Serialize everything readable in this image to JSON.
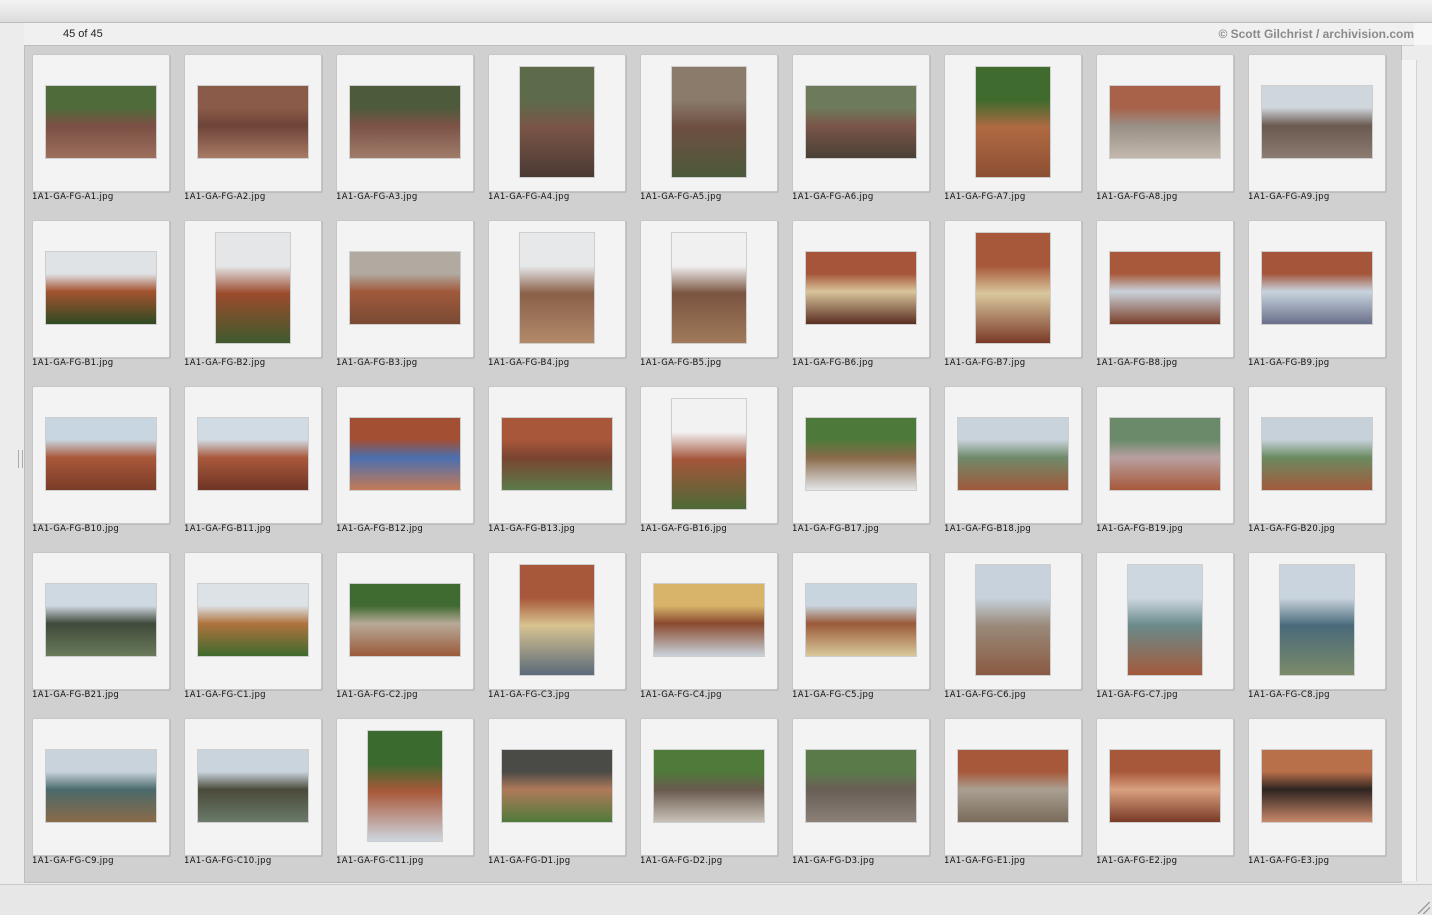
{
  "header": {
    "count": "45 of 45",
    "credit": "© Scott Gilchrist / archivision.com"
  },
  "thumbnails": [
    {
      "name": "1A1-GA-FG-A1.jpg",
      "orientation": "land",
      "palette": [
        "#4f6b3a",
        "#7b5044",
        "#9c6f5c"
      ]
    },
    {
      "name": "1A1-GA-FG-A2.jpg",
      "orientation": "land",
      "palette": [
        "#8a5b49",
        "#6e4438",
        "#a87a66"
      ]
    },
    {
      "name": "1A1-GA-FG-A3.jpg",
      "orientation": "land",
      "palette": [
        "#4e5b3a",
        "#7c5346",
        "#a07c6a"
      ]
    },
    {
      "name": "1A1-GA-FG-A4.jpg",
      "orientation": "port",
      "palette": [
        "#5d6b4a",
        "#7a5547",
        "#4a3a34"
      ]
    },
    {
      "name": "1A1-GA-FG-A5.jpg",
      "orientation": "port",
      "palette": [
        "#8b7b6a",
        "#6e4f42",
        "#4b5a3a"
      ]
    },
    {
      "name": "1A1-GA-FG-A6.jpg",
      "orientation": "land",
      "palette": [
        "#6e7b5a",
        "#7a5649",
        "#4a4036"
      ]
    },
    {
      "name": "1A1-GA-FG-A7.jpg",
      "orientation": "port",
      "palette": [
        "#3f6b2e",
        "#b06a42",
        "#8c4f33"
      ]
    },
    {
      "name": "1A1-GA-FG-A8.jpg",
      "orientation": "land",
      "palette": [
        "#a8624a",
        "#9a8f86",
        "#c2b8ad"
      ]
    },
    {
      "name": "1A1-GA-FG-A9.jpg",
      "orientation": "land",
      "palette": [
        "#cfd6dc",
        "#6a5a50",
        "#8c7b70"
      ]
    },
    {
      "name": "1A1-GA-FG-B1.jpg",
      "orientation": "land",
      "palette": [
        "#dfe3e6",
        "#a4522f",
        "#2e4a22"
      ]
    },
    {
      "name": "1A1-GA-FG-B2.jpg",
      "orientation": "port",
      "palette": [
        "#e4e6e8",
        "#9b4b2c",
        "#3f5a2e"
      ]
    },
    {
      "name": "1A1-GA-FG-B3.jpg",
      "orientation": "land",
      "palette": [
        "#b1aaa0",
        "#a05a3c",
        "#7a4a34"
      ]
    },
    {
      "name": "1A1-GA-FG-B4.jpg",
      "orientation": "port",
      "palette": [
        "#e6e8ea",
        "#8a6048",
        "#b28a6a"
      ]
    },
    {
      "name": "1A1-GA-FG-B5.jpg",
      "orientation": "port",
      "palette": [
        "#f0f0f0",
        "#7a5440",
        "#a07a5a"
      ]
    },
    {
      "name": "1A1-GA-FG-B6.jpg",
      "orientation": "land",
      "palette": [
        "#a6553a",
        "#d8c49a",
        "#5a2e22"
      ]
    },
    {
      "name": "1A1-GA-FG-B7.jpg",
      "orientation": "port",
      "palette": [
        "#a7583a",
        "#d9c79e",
        "#7a3a26"
      ]
    },
    {
      "name": "1A1-GA-FG-B8.jpg",
      "orientation": "land",
      "palette": [
        "#a8593c",
        "#c9d2da",
        "#7b3f2a"
      ]
    },
    {
      "name": "1A1-GA-FG-B9.jpg",
      "orientation": "land",
      "palette": [
        "#a4553a",
        "#c8d4de",
        "#6a6f8a"
      ]
    },
    {
      "name": "1A1-GA-FG-B10.jpg",
      "orientation": "land",
      "palette": [
        "#c8d6e2",
        "#a9583a",
        "#7a3c28"
      ]
    },
    {
      "name": "1A1-GA-FG-B11.jpg",
      "orientation": "land",
      "palette": [
        "#d0dbe4",
        "#a9593c",
        "#6e3424"
      ]
    },
    {
      "name": "1A1-GA-FG-B12.jpg",
      "orientation": "land",
      "palette": [
        "#a24f34",
        "#4a6fb0",
        "#c57a56"
      ]
    },
    {
      "name": "1A1-GA-FG-B13.jpg",
      "orientation": "land",
      "palette": [
        "#a8573a",
        "#7a4430",
        "#5b7a4a"
      ]
    },
    {
      "name": "1A1-GA-FG-B16.jpg",
      "orientation": "port",
      "palette": [
        "#f2f2f2",
        "#a4553a",
        "#4c6a36"
      ]
    },
    {
      "name": "1A1-GA-FG-B17.jpg",
      "orientation": "land",
      "palette": [
        "#4d7a3a",
        "#8a6a4a",
        "#e3e6e8"
      ]
    },
    {
      "name": "1A1-GA-FG-B18.jpg",
      "orientation": "land",
      "palette": [
        "#c9d3dc",
        "#6f8a6a",
        "#a0583a"
      ]
    },
    {
      "name": "1A1-GA-FG-B19.jpg",
      "orientation": "land",
      "palette": [
        "#6a8a6a",
        "#b8a0a0",
        "#a8583a"
      ]
    },
    {
      "name": "1A1-GA-FG-B20.jpg",
      "orientation": "land",
      "palette": [
        "#c6d1da",
        "#6a8a60",
        "#a35a3c"
      ]
    },
    {
      "name": "1A1-GA-FG-B21.jpg",
      "orientation": "land",
      "palette": [
        "#cfd9e2",
        "#3e4a3a",
        "#6a7a5a"
      ]
    },
    {
      "name": "1A1-GA-FG-C1.jpg",
      "orientation": "land",
      "palette": [
        "#dde2e6",
        "#b0733e",
        "#3f6a2e"
      ]
    },
    {
      "name": "1A1-GA-FG-C2.jpg",
      "orientation": "land",
      "palette": [
        "#3f6a30",
        "#b8aa98",
        "#9a5a3a"
      ]
    },
    {
      "name": "1A1-GA-FG-C3.jpg",
      "orientation": "port",
      "palette": [
        "#a8583a",
        "#d8c390",
        "#5a6a7a"
      ]
    },
    {
      "name": "1A1-GA-FG-C4.jpg",
      "orientation": "land",
      "palette": [
        "#d8b46a",
        "#8a4a2e",
        "#c9d2da"
      ]
    },
    {
      "name": "1A1-GA-FG-C5.jpg",
      "orientation": "land",
      "palette": [
        "#c8d4de",
        "#9a5a3a",
        "#d9c89a"
      ]
    },
    {
      "name": "1A1-GA-FG-C6.jpg",
      "orientation": "port",
      "palette": [
        "#c7d2dc",
        "#9a8a7a",
        "#8a5a42"
      ]
    },
    {
      "name": "1A1-GA-FG-C7.jpg",
      "orientation": "port",
      "palette": [
        "#cdd7df",
        "#6a8a8a",
        "#a35a3c"
      ]
    },
    {
      "name": "1A1-GA-FG-C8.jpg",
      "orientation": "port",
      "palette": [
        "#c9d4de",
        "#4a6a7a",
        "#7a8a6a"
      ]
    },
    {
      "name": "1A1-GA-FG-C9.jpg",
      "orientation": "land",
      "palette": [
        "#c8d3dc",
        "#4a6a6a",
        "#8a6a4a"
      ]
    },
    {
      "name": "1A1-GA-FG-C10.jpg",
      "orientation": "land",
      "palette": [
        "#c9d4dd",
        "#4a4a3a",
        "#6a7a6a"
      ]
    },
    {
      "name": "1A1-GA-FG-C11.jpg",
      "orientation": "port",
      "palette": [
        "#3a6a2e",
        "#a9583a",
        "#cdd6de"
      ]
    },
    {
      "name": "1A1-GA-FG-D1.jpg",
      "orientation": "land",
      "palette": [
        "#4a4a46",
        "#b07a5a",
        "#4f7a3a"
      ]
    },
    {
      "name": "1A1-GA-FG-D2.jpg",
      "orientation": "land",
      "palette": [
        "#4f7a3a",
        "#6a5a4e",
        "#c9c2b8"
      ]
    },
    {
      "name": "1A1-GA-FG-D3.jpg",
      "orientation": "land",
      "palette": [
        "#5a7a4a",
        "#6a5f56",
        "#8a8078"
      ]
    },
    {
      "name": "1A1-GA-FG-E1.jpg",
      "orientation": "land",
      "palette": [
        "#a8583a",
        "#a9a092",
        "#7a6a5a"
      ]
    },
    {
      "name": "1A1-GA-FG-E2.jpg",
      "orientation": "land",
      "palette": [
        "#a8583a",
        "#d8a080",
        "#7a3a26"
      ]
    },
    {
      "name": "1A1-GA-FG-E3.jpg",
      "orientation": "land",
      "palette": [
        "#b8704a",
        "#2e2420",
        "#c8886a"
      ]
    }
  ]
}
